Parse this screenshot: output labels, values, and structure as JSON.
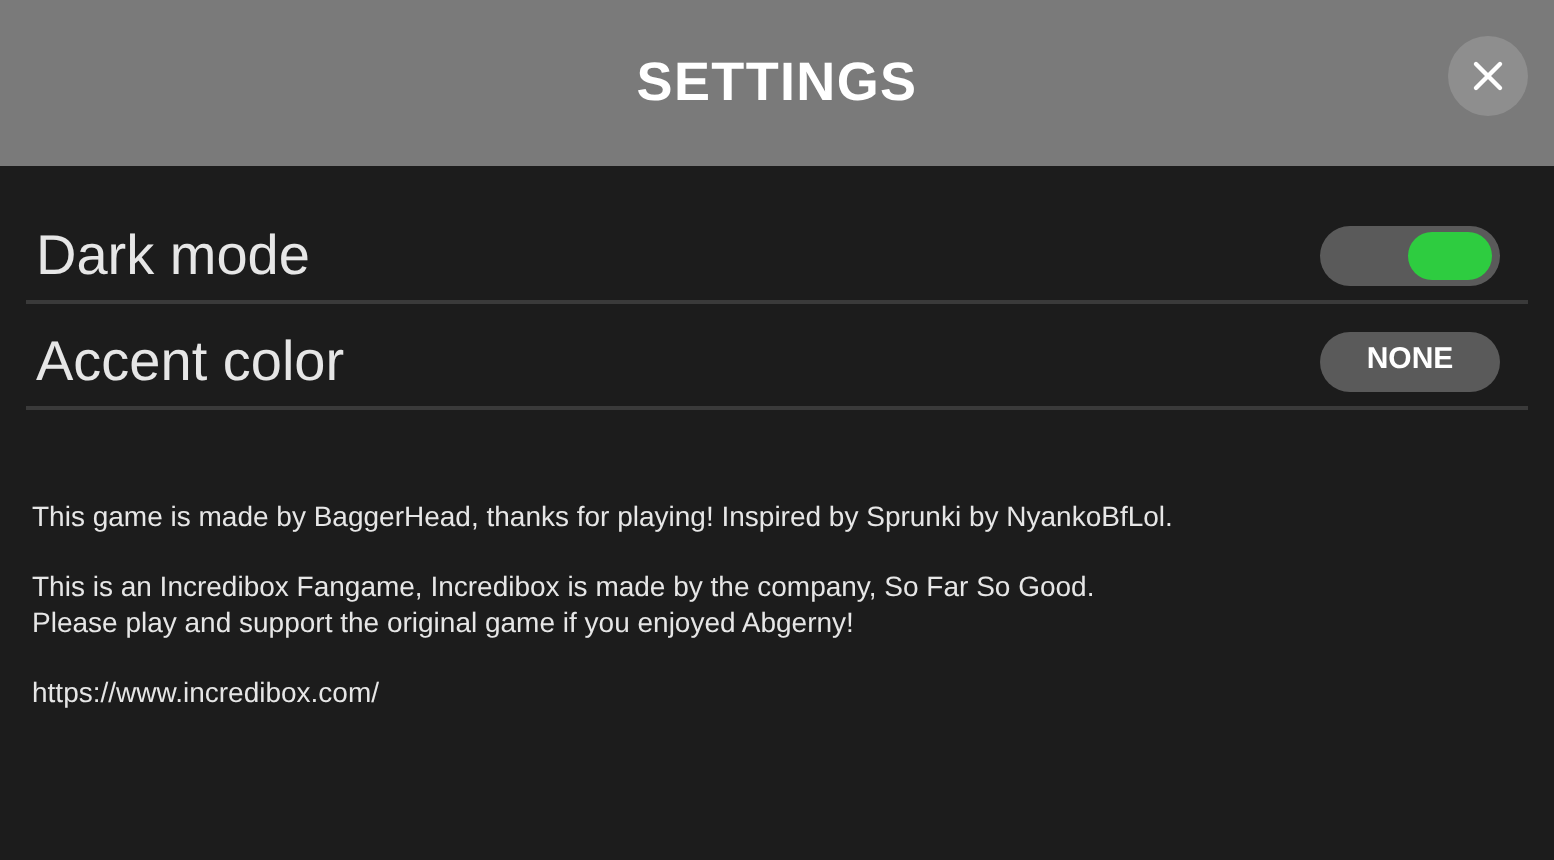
{
  "header": {
    "title": "SETTINGS"
  },
  "settings": [
    {
      "kind": "toggle",
      "label": "Dark mode",
      "on": true
    },
    {
      "kind": "choice",
      "label": "Accent color",
      "value": "NONE"
    }
  ],
  "info": {
    "paragraphs": [
      [
        "This game is made by BaggerHead, thanks for playing! Inspired by Sprunki by NyankoBfLol."
      ],
      [
        "This is an Incredibox Fangame, Incredibox is made by the company, So Far So Good.",
        "Please play and support the original game if you enjoyed Abgerny!"
      ]
    ],
    "link": "https://www.incredibox.com/"
  }
}
